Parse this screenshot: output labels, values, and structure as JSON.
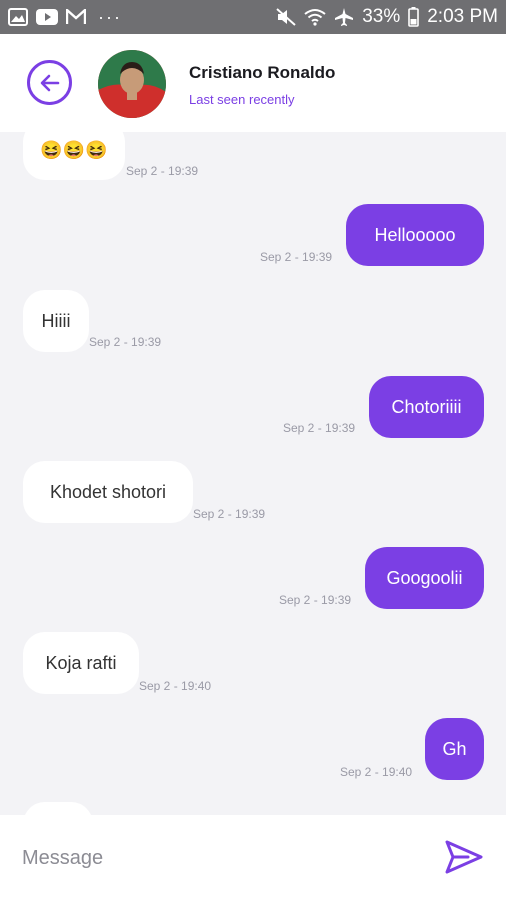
{
  "status_bar": {
    "battery": "33%",
    "time": "2:03 PM",
    "dots": "···"
  },
  "header": {
    "contact_name": "Cristiano Ronaldo",
    "status": "Last seen recently"
  },
  "messages": [
    {
      "direction": "in",
      "text": "😆😆😆",
      "timestamp": "Sep 2  - 19:39"
    },
    {
      "direction": "out",
      "text": "Hellooooo",
      "timestamp": "Sep 2  - 19:39"
    },
    {
      "direction": "in",
      "text": "Hiiii",
      "timestamp": "Sep 2  - 19:39"
    },
    {
      "direction": "out",
      "text": "Chotoriiii",
      "timestamp": "Sep 2  - 19:39"
    },
    {
      "direction": "in",
      "text": "Khodet shotori",
      "timestamp": "Sep 2  - 19:39"
    },
    {
      "direction": "out",
      "text": "Googoolii",
      "timestamp": "Sep 2  - 19:39"
    },
    {
      "direction": "in",
      "text": "Koja rafti",
      "timestamp": "Sep 2  - 19:40"
    },
    {
      "direction": "out",
      "text": "Gh",
      "timestamp": "Sep 2  - 19:40"
    }
  ],
  "composer": {
    "placeholder": "Message"
  },
  "colors": {
    "accent": "#7b3fe4",
    "background": "#f3f3f6"
  }
}
